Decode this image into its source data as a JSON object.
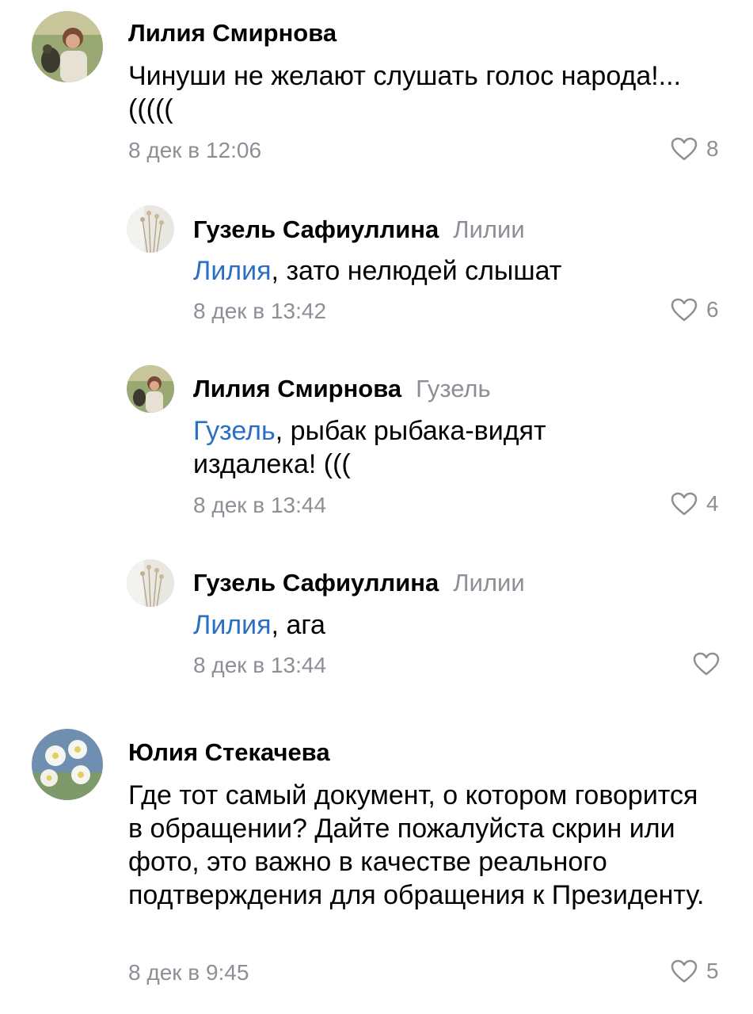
{
  "comments": [
    {
      "author": "Лилия Смирнова",
      "reply_to": "",
      "mention": "",
      "text": "Чинуши не желают слушать голос народа!... (((((",
      "date": "8 дек в 12:06",
      "likes": "8",
      "avatar": "portrait-photo"
    },
    {
      "author": "Гузель Сафиуллина",
      "reply_to": "Лилии",
      "mention": "Лилия",
      "text": ", зато нелюдей слышат",
      "date": "8 дек в 13:42",
      "likes": "6",
      "avatar": "dried-flowers-photo"
    },
    {
      "author": "Лилия Смирнова",
      "reply_to": "Гузель",
      "mention": "Гузель",
      "text": ", рыбак рыбака-видят издалека! (((",
      "date": "8 дек в 13:44",
      "likes": "4",
      "avatar": "portrait-photo"
    },
    {
      "author": "Гузель Сафиуллина",
      "reply_to": "Лилии",
      "mention": "Лилия",
      "text": ", ага",
      "date": "8 дек в 13:44",
      "likes": "",
      "avatar": "dried-flowers-photo"
    },
    {
      "author": "Юлия Стекачева",
      "reply_to": "",
      "mention": "",
      "text": "Где тот самый документ, о котором говорится в обращении? Дайте пожалуйста скрин или фото, это важно в качестве реального подтверждения для обращения к Президенту.",
      "date": "8 дек в 9:45",
      "likes": "5",
      "avatar": "white-flowers-photo"
    }
  ],
  "colors": {
    "mention": "#2a6fc4",
    "secondary_text": "#8c8f96"
  }
}
